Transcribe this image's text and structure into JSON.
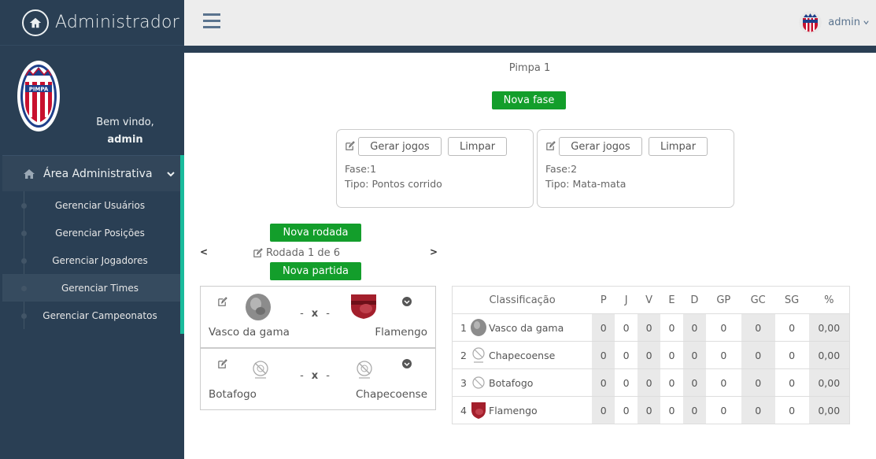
{
  "sidebar": {
    "brand_title": "Administrador",
    "welcome": "Bem vindo,",
    "user": "admin",
    "menu_title": "Área Administrativa",
    "items": [
      {
        "label": "Gerenciar Usuários"
      },
      {
        "label": "Gerenciar Posições"
      },
      {
        "label": "Gerenciar Jogadores"
      },
      {
        "label": "Gerenciar Times"
      },
      {
        "label": "Gerenciar Campeonatos"
      }
    ],
    "active_item": "Gerenciar Times",
    "accent": "#1abb9c"
  },
  "topnav": {
    "user": "admin"
  },
  "main": {
    "championship": "Pimpa 1",
    "new_phase": "Nova fase",
    "phases": [
      {
        "generate": "Gerar jogos",
        "clear": "Limpar",
        "phase": "Fase:1",
        "type": "Tipo: Pontos corrido"
      },
      {
        "generate": "Gerar jogos",
        "clear": "Limpar",
        "phase": "Fase:2",
        "type": "Tipo: Mata-mata"
      }
    ],
    "new_round": "Nova rodada",
    "prev": "<",
    "next": ">",
    "round": "Rodada 1 de 6",
    "new_match": "Nova partida",
    "matches": [
      {
        "home": "Vasco da gama",
        "away": "Flamengo",
        "sep_left": "-",
        "x": "x",
        "sep_right": "-"
      },
      {
        "home": "Botafogo",
        "away": "Chapecoense",
        "sep_left": "-",
        "x": "x",
        "sep_right": "-"
      }
    ],
    "standings": {
      "headers": [
        "Classificação",
        "P",
        "J",
        "V",
        "E",
        "D",
        "GP",
        "GC",
        "SG",
        "%"
      ],
      "rows": [
        {
          "pos": "1",
          "team": "Vasco da gama",
          "P": "0",
          "J": "0",
          "V": "0",
          "E": "0",
          "D": "0",
          "GP": "0",
          "GC": "0",
          "SG": "0",
          "pct": "0,00"
        },
        {
          "pos": "2",
          "team": "Chapecoense",
          "P": "0",
          "J": "0",
          "V": "0",
          "E": "0",
          "D": "0",
          "GP": "0",
          "GC": "0",
          "SG": "0",
          "pct": "0,00"
        },
        {
          "pos": "3",
          "team": "Botafogo",
          "P": "0",
          "J": "0",
          "V": "0",
          "E": "0",
          "D": "0",
          "GP": "0",
          "GC": "0",
          "SG": "0",
          "pct": "0,00"
        },
        {
          "pos": "4",
          "team": "Flamengo",
          "P": "0",
          "J": "0",
          "V": "0",
          "E": "0",
          "D": "0",
          "GP": "0",
          "GC": "0",
          "SG": "0",
          "pct": "0,00"
        }
      ]
    },
    "button_color": "#139e2b"
  }
}
